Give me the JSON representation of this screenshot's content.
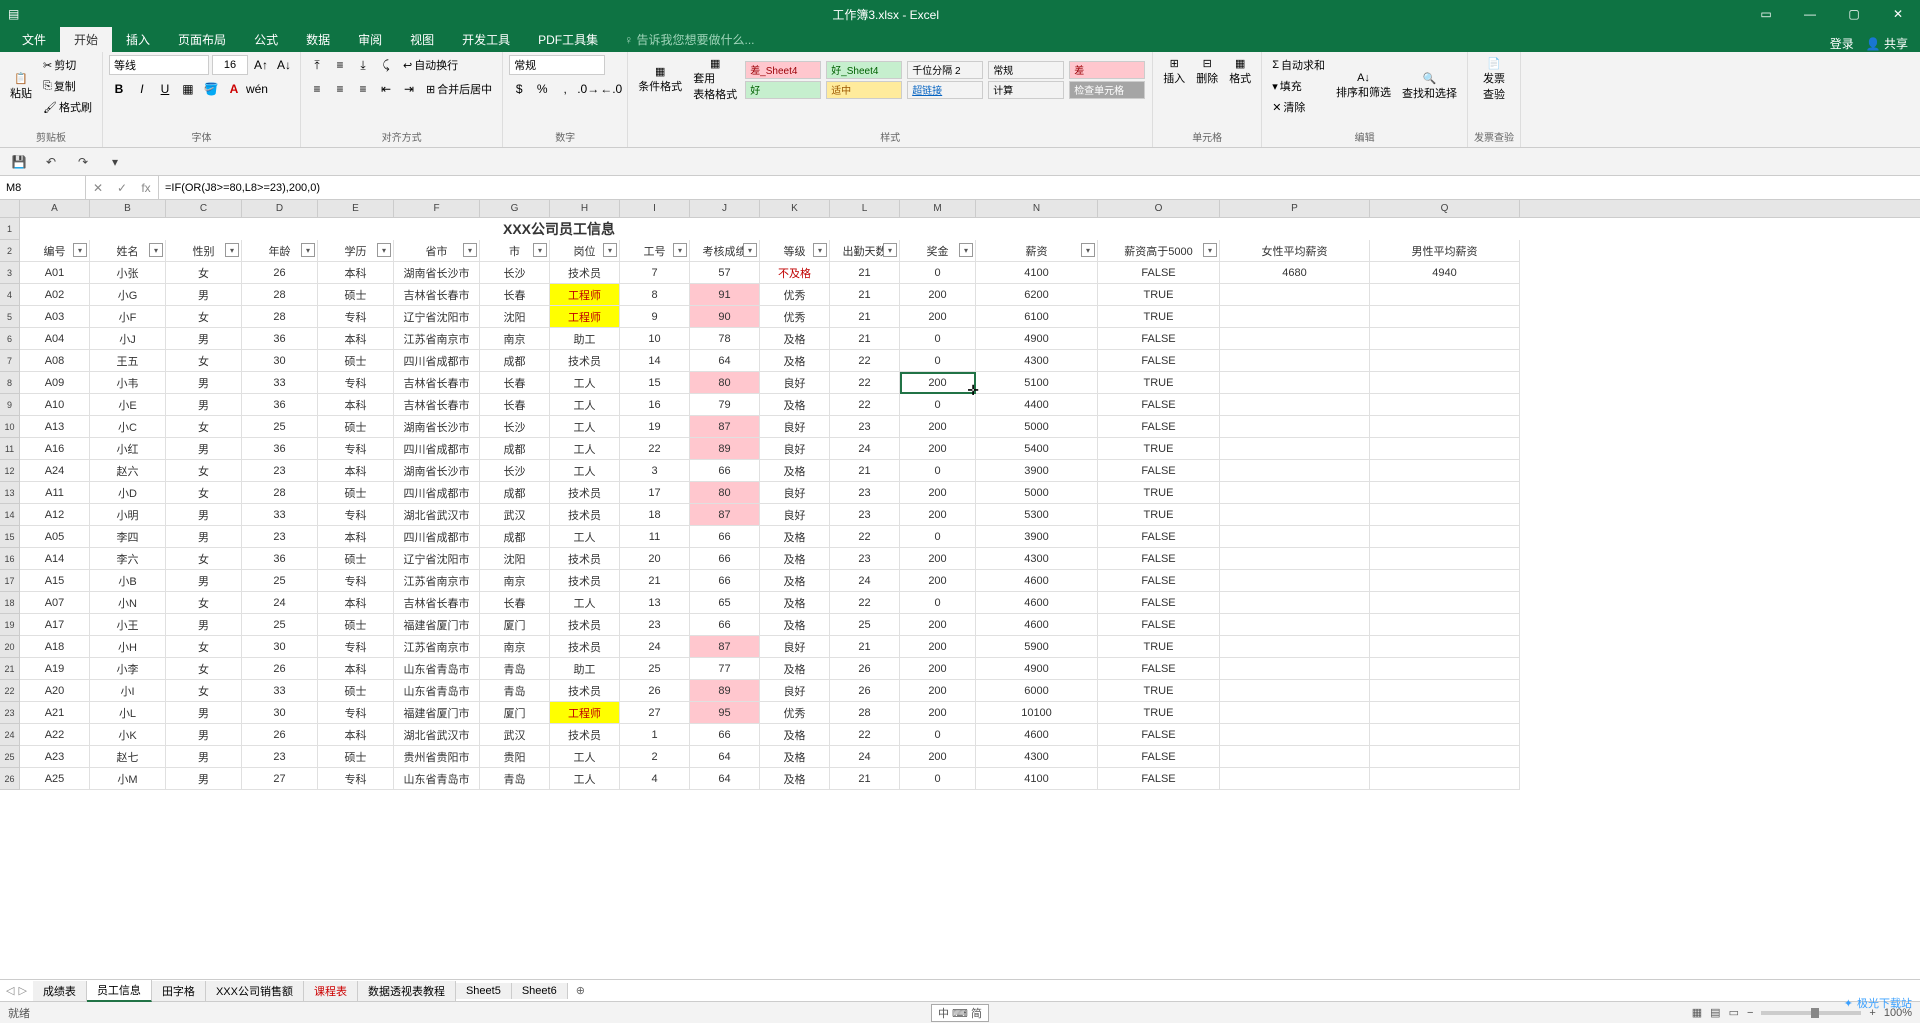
{
  "app": {
    "title": "工作簿3.xlsx - Excel"
  },
  "window_controls": {
    "ribbon_opts": "▭",
    "min": "—",
    "max": "▢",
    "close": "✕"
  },
  "tabs": {
    "file": "文件",
    "home": "开始",
    "insert": "插入",
    "layout": "页面布局",
    "formula": "公式",
    "data": "数据",
    "review": "审阅",
    "view": "视图",
    "dev": "开发工具",
    "pdf": "PDF工具集",
    "tell_me": "告诉我您想要做什么...",
    "login": "登录",
    "share": "共享"
  },
  "ribbon": {
    "clipboard": {
      "paste": "粘贴",
      "cut": "剪切",
      "copy": "复制",
      "format_painter": "格式刷",
      "label": "剪贴板"
    },
    "font": {
      "name": "等线",
      "size": "16",
      "label": "字体"
    },
    "alignment": {
      "wrap": "自动换行",
      "merge": "合并后居中",
      "label": "对齐方式"
    },
    "number": {
      "format": "常规",
      "label": "数字"
    },
    "styles": {
      "cond_fmt": "条件格式",
      "table_fmt": "套用\n表格格式",
      "bad": "差_Sheet4",
      "good": "好_Sheet4",
      "thousand": "千位分隔 2",
      "normal": "常规",
      "badlbl": "差",
      "goodlbl": "好",
      "neutral": "适中",
      "link": "超链接",
      "calc": "计算",
      "check": "检查单元格",
      "label": "样式"
    },
    "cells": {
      "insert": "插入",
      "delete": "删除",
      "format": "格式",
      "label": "单元格"
    },
    "editing": {
      "sum": "自动求和",
      "fill": "填充",
      "clear": "清除",
      "sort": "排序和筛选",
      "find": "查找和选择",
      "label": "编辑"
    },
    "invoice": {
      "check": "发票\n查验",
      "label": "发票查验"
    }
  },
  "formula_bar": {
    "cell_ref": "M8",
    "formula": "=IF(OR(J8>=80,L8>=23),200,0)",
    "fx": "fx"
  },
  "columns": [
    "A",
    "B",
    "C",
    "D",
    "E",
    "F",
    "G",
    "H",
    "I",
    "J",
    "K",
    "L",
    "M",
    "N",
    "O",
    "P",
    "Q"
  ],
  "merged_title": "XXX公司员工信息",
  "headers": [
    "编号",
    "姓名",
    "性别",
    "年龄",
    "学历",
    "省市",
    "市",
    "岗位",
    "工号",
    "考核成绩",
    "等级",
    "出勤天数",
    "奖金",
    "薪资",
    "薪资高于5000",
    "女性平均薪资",
    "男性平均薪资"
  ],
  "summary": {
    "female_avg": "4680",
    "male_avg": "4940"
  },
  "rows": [
    {
      "n": "3",
      "id": "A01",
      "name": "小张",
      "sex": "女",
      "age": "26",
      "edu": "本科",
      "prov": "湖南省长沙市",
      "city": "长沙",
      "job": "技术员",
      "eno": "7",
      "score": "57",
      "grade": "不及格",
      "days": "21",
      "bonus": "0",
      "sal": "4100",
      "gt": "FALSE",
      "hlScore": false,
      "hlJob": false,
      "gradeRed": true
    },
    {
      "n": "4",
      "id": "A02",
      "name": "小G",
      "sex": "男",
      "age": "28",
      "edu": "硕士",
      "prov": "吉林省长春市",
      "city": "长春",
      "job": "工程师",
      "eno": "8",
      "score": "91",
      "grade": "优秀",
      "days": "21",
      "bonus": "200",
      "sal": "6200",
      "gt": "TRUE",
      "hlScore": true,
      "hlJob": true
    },
    {
      "n": "5",
      "id": "A03",
      "name": "小F",
      "sex": "女",
      "age": "28",
      "edu": "专科",
      "prov": "辽宁省沈阳市",
      "city": "沈阳",
      "job": "工程师",
      "eno": "9",
      "score": "90",
      "grade": "优秀",
      "days": "21",
      "bonus": "200",
      "sal": "6100",
      "gt": "TRUE",
      "hlScore": true,
      "hlJob": true
    },
    {
      "n": "6",
      "id": "A04",
      "name": "小J",
      "sex": "男",
      "age": "36",
      "edu": "本科",
      "prov": "江苏省南京市",
      "city": "南京",
      "job": "助工",
      "eno": "10",
      "score": "78",
      "grade": "及格",
      "days": "21",
      "bonus": "0",
      "sal": "4900",
      "gt": "FALSE"
    },
    {
      "n": "7",
      "id": "A08",
      "name": "王五",
      "sex": "女",
      "age": "30",
      "edu": "硕士",
      "prov": "四川省成都市",
      "city": "成都",
      "job": "技术员",
      "eno": "14",
      "score": "64",
      "grade": "及格",
      "days": "22",
      "bonus": "0",
      "sal": "4300",
      "gt": "FALSE"
    },
    {
      "n": "8",
      "id": "A09",
      "name": "小韦",
      "sex": "男",
      "age": "33",
      "edu": "专科",
      "prov": "吉林省长春市",
      "city": "长春",
      "job": "工人",
      "eno": "15",
      "score": "80",
      "grade": "良好",
      "days": "22",
      "bonus": "200",
      "sal": "5100",
      "gt": "TRUE",
      "hlScore": true,
      "selected": true
    },
    {
      "n": "9",
      "id": "A10",
      "name": "小E",
      "sex": "男",
      "age": "36",
      "edu": "本科",
      "prov": "吉林省长春市",
      "city": "长春",
      "job": "工人",
      "eno": "16",
      "score": "79",
      "grade": "及格",
      "days": "22",
      "bonus": "0",
      "sal": "4400",
      "gt": "FALSE"
    },
    {
      "n": "10",
      "id": "A13",
      "name": "小C",
      "sex": "女",
      "age": "25",
      "edu": "硕士",
      "prov": "湖南省长沙市",
      "city": "长沙",
      "job": "工人",
      "eno": "19",
      "score": "87",
      "grade": "良好",
      "days": "23",
      "bonus": "200",
      "sal": "5000",
      "gt": "FALSE",
      "hlScore": true
    },
    {
      "n": "11",
      "id": "A16",
      "name": "小红",
      "sex": "男",
      "age": "36",
      "edu": "专科",
      "prov": "四川省成都市",
      "city": "成都",
      "job": "工人",
      "eno": "22",
      "score": "89",
      "grade": "良好",
      "days": "24",
      "bonus": "200",
      "sal": "5400",
      "gt": "TRUE",
      "hlScore": true
    },
    {
      "n": "12",
      "id": "A24",
      "name": "赵六",
      "sex": "女",
      "age": "23",
      "edu": "本科",
      "prov": "湖南省长沙市",
      "city": "长沙",
      "job": "工人",
      "eno": "3",
      "score": "66",
      "grade": "及格",
      "days": "21",
      "bonus": "0",
      "sal": "3900",
      "gt": "FALSE"
    },
    {
      "n": "13",
      "id": "A11",
      "name": "小D",
      "sex": "女",
      "age": "28",
      "edu": "硕士",
      "prov": "四川省成都市",
      "city": "成都",
      "job": "技术员",
      "eno": "17",
      "score": "80",
      "grade": "良好",
      "days": "23",
      "bonus": "200",
      "sal": "5000",
      "gt": "TRUE",
      "hlScore": true
    },
    {
      "n": "14",
      "id": "A12",
      "name": "小明",
      "sex": "男",
      "age": "33",
      "edu": "专科",
      "prov": "湖北省武汉市",
      "city": "武汉",
      "job": "技术员",
      "eno": "18",
      "score": "87",
      "grade": "良好",
      "days": "23",
      "bonus": "200",
      "sal": "5300",
      "gt": "TRUE",
      "hlScore": true
    },
    {
      "n": "15",
      "id": "A05",
      "name": "李四",
      "sex": "男",
      "age": "23",
      "edu": "本科",
      "prov": "四川省成都市",
      "city": "成都",
      "job": "工人",
      "eno": "11",
      "score": "66",
      "grade": "及格",
      "days": "22",
      "bonus": "0",
      "sal": "3900",
      "gt": "FALSE"
    },
    {
      "n": "16",
      "id": "A14",
      "name": "李六",
      "sex": "女",
      "age": "36",
      "edu": "硕士",
      "prov": "辽宁省沈阳市",
      "city": "沈阳",
      "job": "技术员",
      "eno": "20",
      "score": "66",
      "grade": "及格",
      "days": "23",
      "bonus": "200",
      "sal": "4300",
      "gt": "FALSE"
    },
    {
      "n": "17",
      "id": "A15",
      "name": "小B",
      "sex": "男",
      "age": "25",
      "edu": "专科",
      "prov": "江苏省南京市",
      "city": "南京",
      "job": "技术员",
      "eno": "21",
      "score": "66",
      "grade": "及格",
      "days": "24",
      "bonus": "200",
      "sal": "4600",
      "gt": "FALSE"
    },
    {
      "n": "18",
      "id": "A07",
      "name": "小N",
      "sex": "女",
      "age": "24",
      "edu": "本科",
      "prov": "吉林省长春市",
      "city": "长春",
      "job": "工人",
      "eno": "13",
      "score": "65",
      "grade": "及格",
      "days": "22",
      "bonus": "0",
      "sal": "4600",
      "gt": "FALSE"
    },
    {
      "n": "19",
      "id": "A17",
      "name": "小王",
      "sex": "男",
      "age": "25",
      "edu": "硕士",
      "prov": "福建省厦门市",
      "city": "厦门",
      "job": "技术员",
      "eno": "23",
      "score": "66",
      "grade": "及格",
      "days": "25",
      "bonus": "200",
      "sal": "4600",
      "gt": "FALSE"
    },
    {
      "n": "20",
      "id": "A18",
      "name": "小H",
      "sex": "女",
      "age": "30",
      "edu": "专科",
      "prov": "江苏省南京市",
      "city": "南京",
      "job": "技术员",
      "eno": "24",
      "score": "87",
      "grade": "良好",
      "days": "21",
      "bonus": "200",
      "sal": "5900",
      "gt": "TRUE",
      "hlScore": true
    },
    {
      "n": "21",
      "id": "A19",
      "name": "小李",
      "sex": "女",
      "age": "26",
      "edu": "本科",
      "prov": "山东省青岛市",
      "city": "青岛",
      "job": "助工",
      "eno": "25",
      "score": "77",
      "grade": "及格",
      "days": "26",
      "bonus": "200",
      "sal": "4900",
      "gt": "FALSE"
    },
    {
      "n": "22",
      "id": "A20",
      "name": "小I",
      "sex": "女",
      "age": "33",
      "edu": "硕士",
      "prov": "山东省青岛市",
      "city": "青岛",
      "job": "技术员",
      "eno": "26",
      "score": "89",
      "grade": "良好",
      "days": "26",
      "bonus": "200",
      "sal": "6000",
      "gt": "TRUE",
      "hlScore": true
    },
    {
      "n": "23",
      "id": "A21",
      "name": "小L",
      "sex": "男",
      "age": "30",
      "edu": "专科",
      "prov": "福建省厦门市",
      "city": "厦门",
      "job": "工程师",
      "eno": "27",
      "score": "95",
      "grade": "优秀",
      "days": "28",
      "bonus": "200",
      "sal": "10100",
      "gt": "TRUE",
      "hlScore": true,
      "hlJob": true
    },
    {
      "n": "24",
      "id": "A22",
      "name": "小K",
      "sex": "男",
      "age": "26",
      "edu": "本科",
      "prov": "湖北省武汉市",
      "city": "武汉",
      "job": "技术员",
      "eno": "1",
      "score": "66",
      "grade": "及格",
      "days": "22",
      "bonus": "0",
      "sal": "4600",
      "gt": "FALSE"
    },
    {
      "n": "25",
      "id": "A23",
      "name": "赵七",
      "sex": "男",
      "age": "23",
      "edu": "硕士",
      "prov": "贵州省贵阳市",
      "city": "贵阳",
      "job": "工人",
      "eno": "2",
      "score": "64",
      "grade": "及格",
      "days": "24",
      "bonus": "200",
      "sal": "4300",
      "gt": "FALSE"
    },
    {
      "n": "26",
      "id": "A25",
      "name": "小M",
      "sex": "男",
      "age": "27",
      "edu": "专科",
      "prov": "山东省青岛市",
      "city": "青岛",
      "job": "工人",
      "eno": "4",
      "score": "64",
      "grade": "及格",
      "days": "21",
      "bonus": "0",
      "sal": "4100",
      "gt": "FALSE"
    }
  ],
  "sheet_tabs": {
    "nav_prev": "◁",
    "nav_next": "▷",
    "t1": "成绩表",
    "t2": "员工信息",
    "t3": "田字格",
    "t4": "XXX公司销售额",
    "t5": "课程表",
    "t6": "数据透视表教程",
    "t7": "Sheet5",
    "t8": "Sheet6",
    "add": "⊕"
  },
  "status": {
    "mode": "就绪",
    "ime_hint": "中 ⌨ 简",
    "zoom": "100%",
    "plus": "+",
    "minus": "−"
  },
  "watermark": "极光下载站"
}
